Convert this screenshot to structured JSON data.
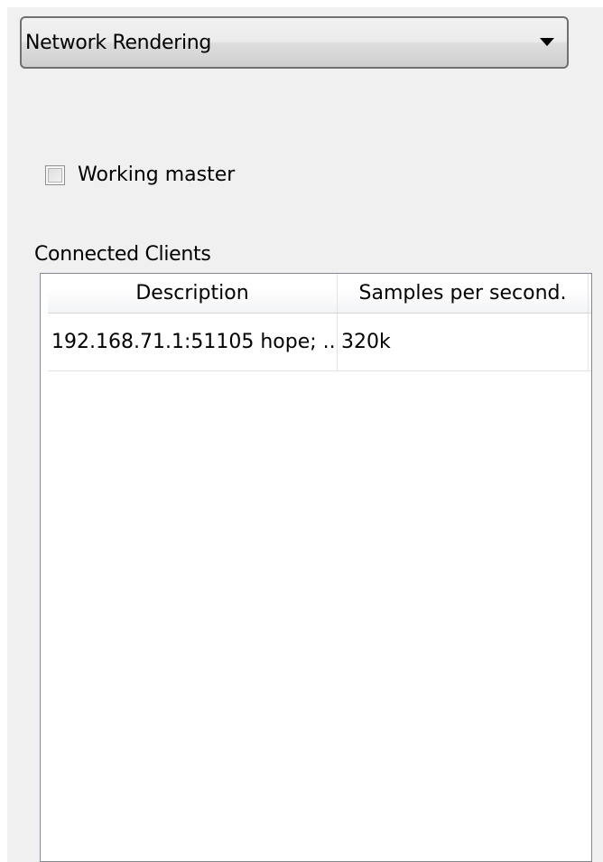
{
  "render_mode": {
    "select": {
      "value": "Network Rendering",
      "icon": "chevron-down-icon"
    }
  },
  "working_master": {
    "label": "Working master",
    "checked": false
  },
  "connected_clients": {
    "label": "Connected Clients",
    "columns": [
      "Description",
      "Samples per second."
    ],
    "rows": [
      {
        "description": "192.168.71.1:51105 hope; ...",
        "samples_per_second": "320k"
      }
    ]
  }
}
